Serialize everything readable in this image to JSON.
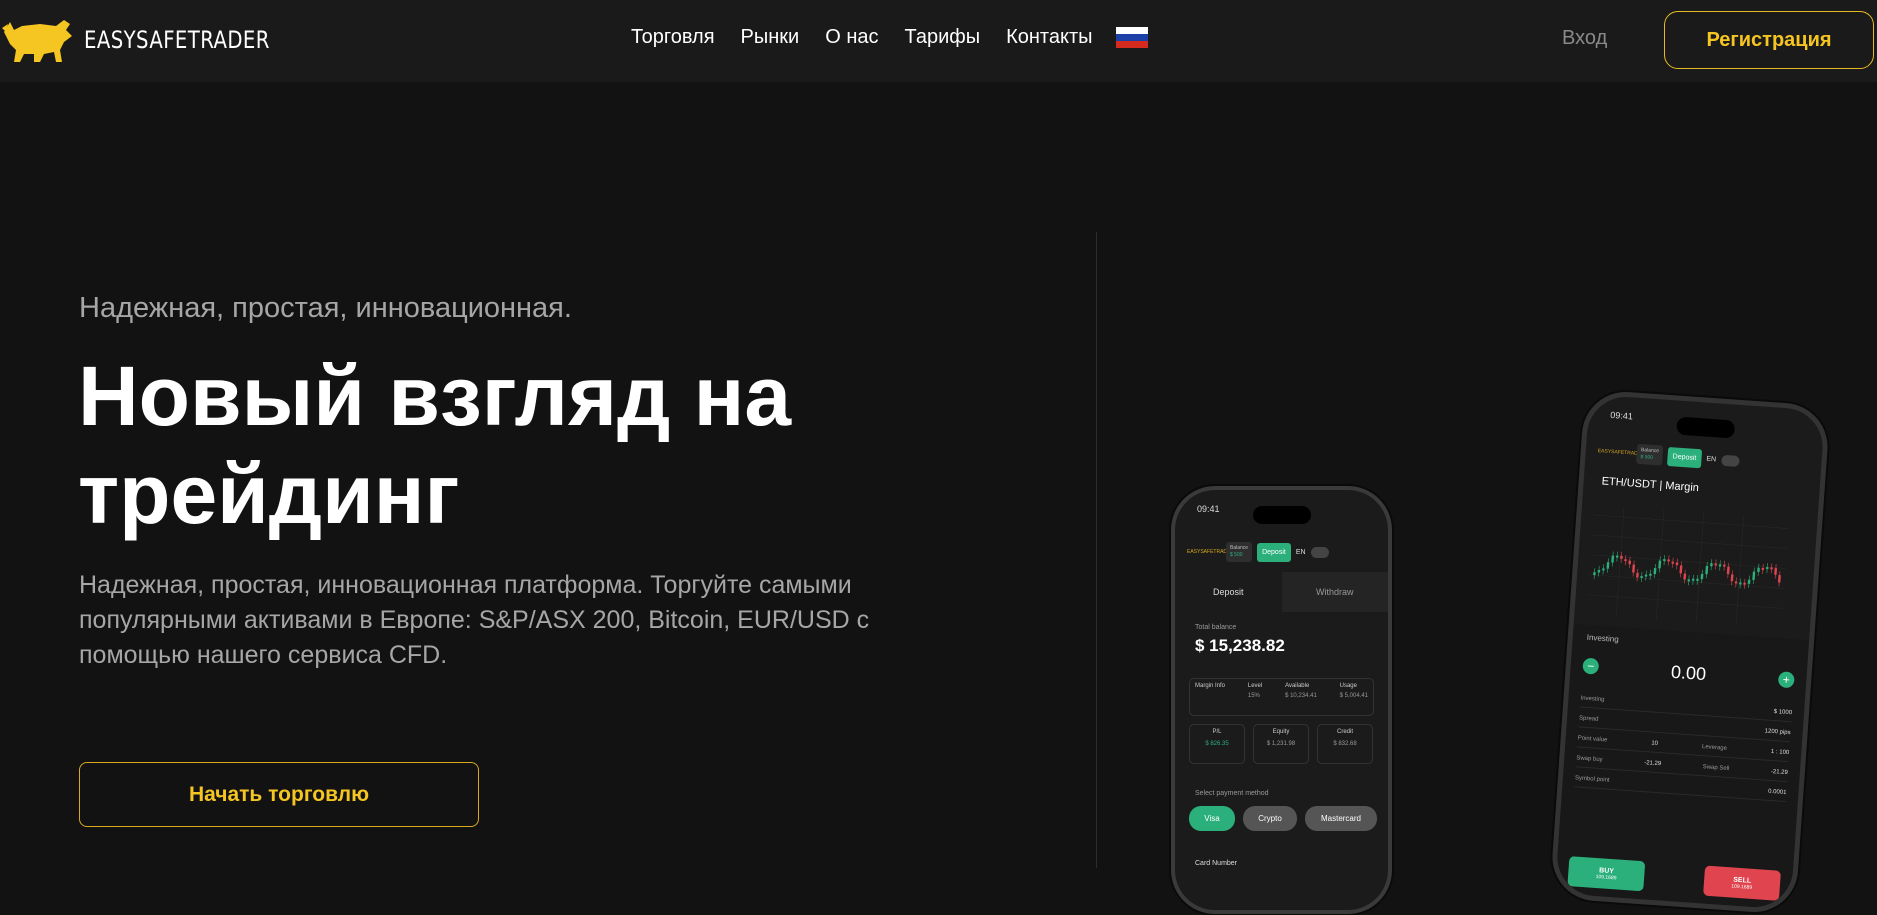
{
  "brand": {
    "name": "EASYSAFETRADER",
    "accent": "#f5c521",
    "logo_icon": "bull-icon"
  },
  "nav": {
    "items": [
      "Торговля",
      "Рынки",
      "О нас",
      "Тарифы",
      "Контакты"
    ],
    "language_flag_icon": "russia-flag-icon"
  },
  "auth": {
    "login": "Вход",
    "register": "Регистрация"
  },
  "hero": {
    "tagline": "Надежная, простая, инновационная.",
    "headline": "Новый взгляд на трейдинг",
    "description": "Надежная, простая, инновационная платформа. Торгуйте самыми популярными активами в Европе: S&P/ASX 200, Bitcoin, EUR/USD с помощью нашего сервиса CFD.",
    "cta": "Начать торговлю"
  },
  "phone_left": {
    "time": "09:41",
    "balance_label": "Balance",
    "balance_value": "$ 500",
    "deposit": "Deposit",
    "lang": "EN",
    "tabs": [
      "Deposit",
      "Withdraw"
    ],
    "total_balance_label": "Total balance",
    "total_balance": "$ 15,238.82",
    "margin_info_label": "Margin Info",
    "level_label": "Level",
    "level_value": "15%",
    "available_label": "Available",
    "available_value": "$ 10,234.41",
    "usage_label": "Usage",
    "usage_value": "$ 5,004.41",
    "pl_label": "P/L",
    "pl_value": "$ 826.35",
    "equity_label": "Equity",
    "equity_value": "$ 1,231.98",
    "credit_label": "Credit",
    "credit_value": "$ 832.68",
    "payment_label": "Select payment method",
    "payment_methods": [
      "Visa",
      "Crypto",
      "Mastercard"
    ],
    "card_number_label": "Card Number"
  },
  "phone_right": {
    "time": "09:41",
    "balance_label": "Balance",
    "balance_value": "$ 500",
    "deposit": "Deposit",
    "lang": "EN",
    "pair": "ETH/USDT | Margin",
    "investing_label": "Investing",
    "amount": "0.00",
    "rows": [
      {
        "label": "Investing",
        "value": "$ 1000"
      },
      {
        "label": "Spread",
        "value": "1200 pips"
      },
      {
        "label": "Point value",
        "value": "10"
      },
      {
        "label": "Swap buy",
        "value": "-21.29"
      },
      {
        "label": "Symbol point",
        "value": "0.0001"
      }
    ],
    "leverage_label": "Leverage",
    "leverage_value": "1 : 100",
    "swap_sell_label": "Swap Sell",
    "swap_sell_value": "-21.29",
    "buy_label": "BUY",
    "buy_price": "109.1689",
    "sell_label": "SELL",
    "sell_price": "109.1689"
  }
}
